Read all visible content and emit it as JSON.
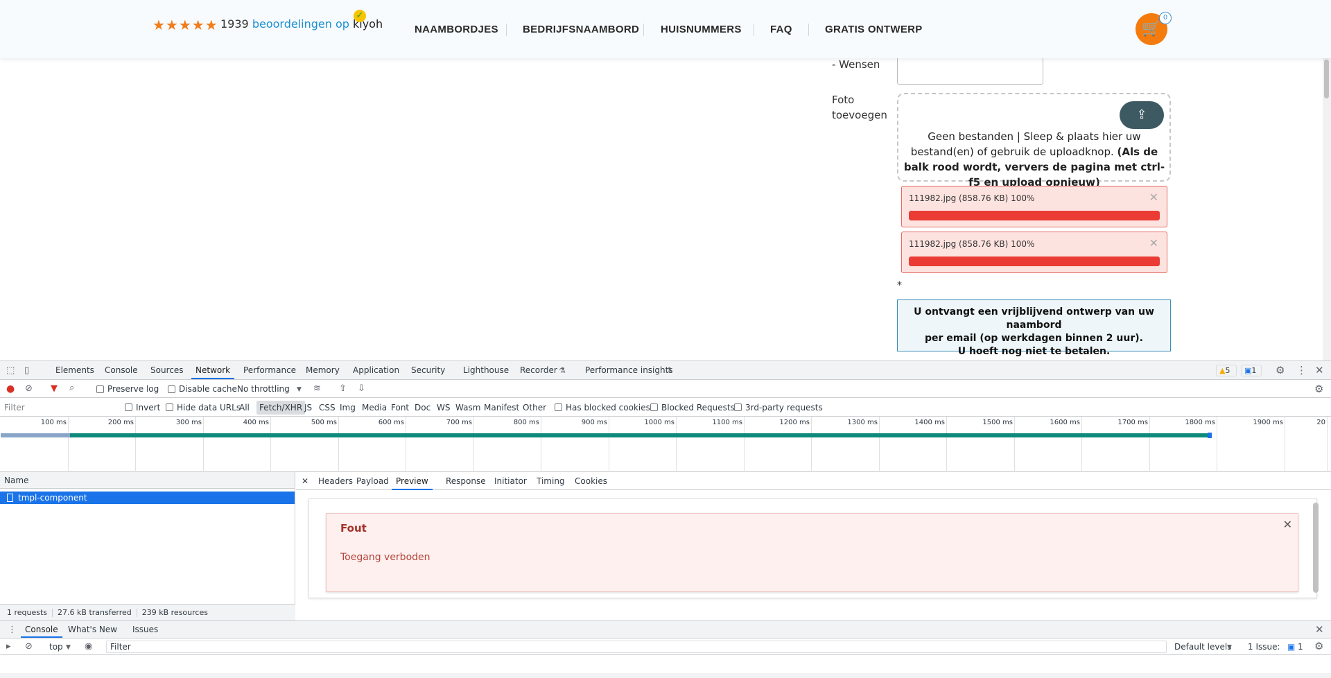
{
  "header": {
    "rating_count": "1939",
    "rating_link": "beoordelingen op",
    "rating_brand": "kiyoh",
    "nav": [
      "NAAMBORDJES",
      "BEDRIJFSNAAMBORD",
      "HUISNUMMERS",
      "FAQ",
      "GRATIS ONTWERP"
    ],
    "cart_count": "0",
    "accent_color": "#f47b0e",
    "stars_value": 5
  },
  "form": {
    "wensen_label": "- Wensen",
    "foto_label_line1": "Foto",
    "foto_label_line2": "toevoegen",
    "drop_text_plain": "Geen bestanden | Sleep & plaats hier uw bestand(en) of gebruik de uploadknop.",
    "drop_text_bold": "(Als de balk rood wordt, ververs de pagina met ctrl-f5 en upload opnieuw)",
    "files": [
      {
        "name": "111982.jpg (858.76 KB)  100%",
        "progress": 1.0
      },
      {
        "name": "111982.jpg (858.76 KB)  100%",
        "progress": 1.0
      }
    ],
    "asterisk": "*",
    "notice_line1": "U ontvangt een vrijblijvend ontwerp van uw naambord",
    "notice_line2": "per email (op werkdagen binnen 2 uur).",
    "notice_line3": "U hoeft nog niet te betalen."
  },
  "devtools": {
    "tabs": [
      "Elements",
      "Console",
      "Sources",
      "Network",
      "Performance",
      "Memory",
      "Application",
      "Security",
      "Lighthouse",
      "Recorder",
      "Performance insights"
    ],
    "active_tab": "Network",
    "warnings": "5",
    "messages": "1",
    "toolbar": {
      "preserve_log": "Preserve log",
      "disable_cache": "Disable cache",
      "throttling": "No throttling"
    },
    "filter_bar": {
      "filter_placeholder": "Filter",
      "invert": "Invert",
      "hide_data_urls": "Hide data URLs",
      "types": [
        "All",
        "Fetch/XHR",
        "JS",
        "CSS",
        "Img",
        "Media",
        "Font",
        "Doc",
        "WS",
        "Wasm",
        "Manifest",
        "Other"
      ],
      "has_blocked_cookies": "Has blocked cookies",
      "blocked_requests": "Blocked Requests",
      "third_party": "3rd-party requests"
    },
    "timeline_ticks": [
      "100 ms",
      "200 ms",
      "300 ms",
      "400 ms",
      "500 ms",
      "600 ms",
      "700 ms",
      "800 ms",
      "900 ms",
      "1000 ms",
      "1100 ms",
      "1200 ms",
      "1300 ms",
      "1400 ms",
      "1500 ms",
      "1600 ms",
      "1700 ms",
      "1800 ms",
      "1900 ms",
      "20"
    ],
    "request_list": {
      "header": "Name",
      "rows": [
        "tmpl-component"
      ],
      "summary_requests": "1 requests",
      "summary_transferred": "27.6 kB transferred",
      "summary_resources": "239 kB resources"
    },
    "detail_tabs": [
      "Headers",
      "Payload",
      "Preview",
      "Response",
      "Initiator",
      "Timing",
      "Cookies"
    ],
    "active_detail_tab": "Preview",
    "preview": {
      "title": "Fout",
      "message": "Toegang verboden"
    },
    "drawer": {
      "tabs": [
        "Console",
        "What's New",
        "Issues"
      ],
      "context": "top",
      "filter_placeholder": "Filter",
      "levels": "Default levels",
      "issues": "1 Issue:",
      "issues_count": "1"
    }
  }
}
